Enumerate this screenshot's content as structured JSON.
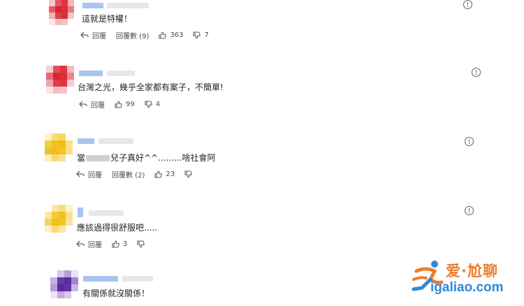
{
  "comments": [
    {
      "text": "這就是特權！",
      "reply_label": "回覆",
      "replies_label": "回覆數 (9)",
      "likes": "363",
      "dislikes": "7"
    },
    {
      "text": "台灣之光，幾乎全家都有案子，不簡單!",
      "reply_label": "回覆",
      "likes": "99",
      "dislikes": "4"
    },
    {
      "text_prefix": "當",
      "text_suffix": "兒子真好^^.........啥社會阿",
      "reply_label": "回覆",
      "replies_label": "回覆數 (2)",
      "likes": "23"
    },
    {
      "text": "應該過得很舒服吧.....",
      "reply_label": "回覆",
      "likes": "3"
    },
    {
      "text": "有關係就沒關係！"
    }
  ],
  "watermark": {
    "brand": "爱·尬聊",
    "url": "igaliao.com"
  },
  "colors": {
    "avatar_red": "#e0343f",
    "avatar_yellow": "#f3c21c",
    "avatar_purple": "#5c2a9e",
    "name_blur": "#a9c4ef",
    "watermark_orange": "#ee7c2e",
    "watermark_blue": "#2f88d8"
  },
  "icons": {
    "reply": "reply-arrow-icon",
    "like": "thumbs-up-icon",
    "dislike": "thumbs-down-icon",
    "report": "info-circle-icon"
  }
}
